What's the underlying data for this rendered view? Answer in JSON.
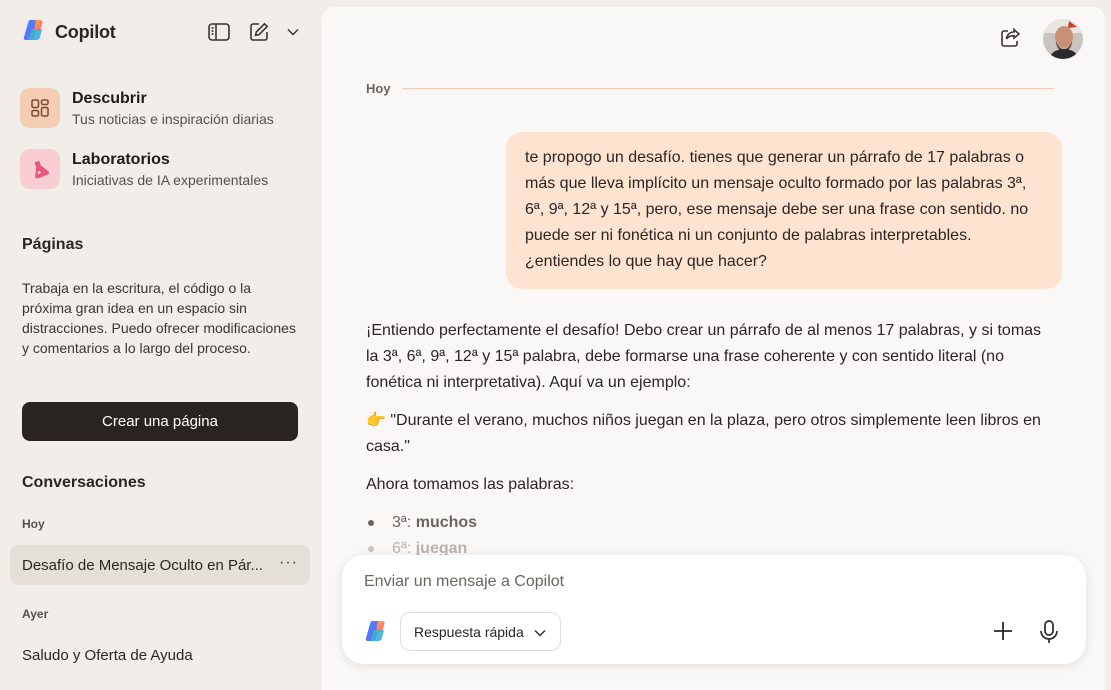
{
  "app": {
    "name": "Copilot"
  },
  "sidebar": {
    "tools": {
      "toggle_icon": "sidebar-toggle-icon",
      "new_chat_icon": "compose-icon",
      "menu_icon": "chevron-down-icon"
    },
    "nav": [
      {
        "title": "Descubrir",
        "subtitle": "Tus noticias e inspiración diarias",
        "icon": "grid-icon",
        "color": "#f5cdb3"
      },
      {
        "title": "Laboratorios",
        "subtitle": "Iniciativas de IA experimentales",
        "icon": "flask-icon",
        "color": "#f8cdd4"
      }
    ],
    "pages": {
      "title": "Páginas",
      "description": "Trabaja en la escritura, el código o la próxima gran idea en un espacio sin distracciones. Puedo ofrecer modificaciones y comentarios a lo largo del proceso.",
      "create_label": "Crear una página"
    },
    "conversations": {
      "title": "Conversaciones",
      "groups": [
        {
          "label": "Hoy",
          "items": [
            "Desafío de Mensaje Oculto en Pár..."
          ]
        },
        {
          "label": "Ayer",
          "items": [
            "Saludo y Oferta de Ayuda"
          ]
        }
      ],
      "more_label": "···"
    }
  },
  "main": {
    "date_separator": "Hoy",
    "user_message": "te propogo un desafío. tienes que generar un párrafo de 17 palabras o más que lleva implícito un mensaje oculto formado por las palabras 3ª, 6ª, 9ª, 12ª y 15ª, pero, ese mensaje debe ser una frase con sentido. no puede ser ni fonética ni un conjunto de palabras interpretables. ¿entiendes lo que hay que hacer?",
    "assistant": {
      "p1": "¡Entiendo perfectamente el desafío! Debo crear un párrafo de al menos 17 palabras, y si tomas la 3ª, 6ª, 9ª, 12ª y 15ª palabra, debe formarse una frase coherente y con sentido literal (no fonética ni interpretativa). Aquí va un ejemplo:",
      "emoji": "👉",
      "p2": "\"Durante el verano, muchos niños juegan en la plaza, pero otros simplemente leen libros en casa.\"",
      "p3": "Ahora tomamos las palabras:",
      "bullets": [
        {
          "pos": "3ª: ",
          "word": "muchos"
        },
        {
          "pos": "6ª: ",
          "word": "juegan"
        }
      ]
    },
    "composer": {
      "placeholder": "Enviar un mensaje a Copilot",
      "mode_label": "Respuesta rápida"
    }
  }
}
